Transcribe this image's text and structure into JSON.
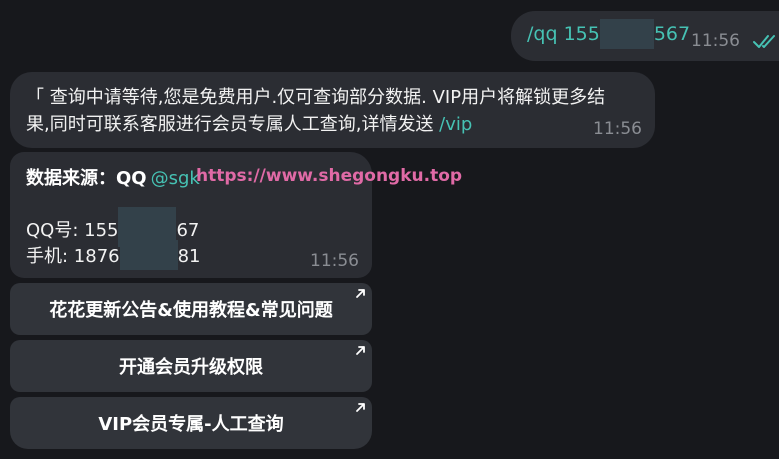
{
  "outgoing": {
    "command": "/qq",
    "number_start": "155",
    "number_end": "567",
    "time": "11:56"
  },
  "incoming_notice": {
    "line1": "「 查询中请等待,您是免费用户.仅可查询部分数据. VIP用户将解锁更多结",
    "line2_text": "果,同时可联系客服进行会员专属人工查询,详情发送 ",
    "line2_link": "/vip",
    "time": "11:56"
  },
  "result": {
    "source_label": "数据来源：QQ",
    "mention": "@sgk",
    "watermark": "https://www.shegongku.top",
    "qq_label": "QQ号: ",
    "qq_start": "155",
    "qq_end": "67",
    "phone_label": "手机: ",
    "phone_start": "1876",
    "phone_end": "81",
    "time": "11:56"
  },
  "buttons": [
    {
      "label": "花花更新公告&使用教程&常见问题"
    },
    {
      "label": "开通会员升级权限"
    },
    {
      "label": "VIP会员专属-人工查询"
    }
  ],
  "colors": {
    "background": "#17181c",
    "bubble": "#2b2d33",
    "accent": "#46c2b4",
    "watermark": "#e06aa6",
    "time": "#8a8d93"
  }
}
